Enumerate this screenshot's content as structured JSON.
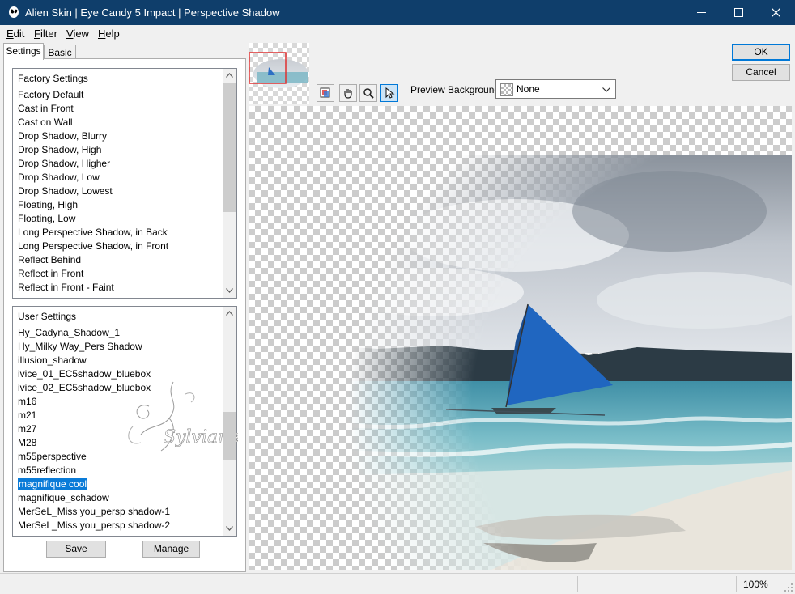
{
  "window": {
    "title": "Alien Skin | Eye Candy 5 Impact | Perspective Shadow",
    "controls": [
      "minimize-icon",
      "maximize-icon",
      "close-icon"
    ]
  },
  "menu": {
    "edit": {
      "accel": "E",
      "rest": "dit"
    },
    "filter": {
      "accel": "F",
      "rest": "ilter"
    },
    "view": {
      "accel": "V",
      "rest": "iew"
    },
    "help": {
      "accel": "H",
      "rest": "elp"
    }
  },
  "tabs": {
    "settings": "Settings",
    "basic": "Basic"
  },
  "factory": {
    "header": "Factory Settings",
    "items": [
      "Factory Default",
      "Cast in Front",
      "Cast on Wall",
      "Drop Shadow, Blurry",
      "Drop Shadow, High",
      "Drop Shadow, Higher",
      "Drop Shadow, Low",
      "Drop Shadow, Lowest",
      "Floating, High",
      "Floating, Low",
      "Long Perspective Shadow, in Back",
      "Long Perspective Shadow, in Front",
      "Reflect Behind",
      "Reflect in Front",
      "Reflect in Front - Faint"
    ]
  },
  "user": {
    "header": "User Settings",
    "selected": "magnifique cool",
    "items": [
      "Hy_Cadyna_Shadow_1",
      "Hy_Milky Way_Pers Shadow",
      "illusion_shadow",
      "ivice_01_EC5shadow_bluebox",
      "ivice_02_EC5shadow_bluebox",
      "m16",
      "m21",
      "m27",
      "M28",
      "m55perspective",
      "m55reflection",
      "magnifique cool",
      "magnifique_schadow",
      "MerSeL_Miss you_persp shadow-1",
      "MerSeL_Miss you_persp shadow-2"
    ]
  },
  "buttons": {
    "save": "Save",
    "manage": "Manage",
    "ok": "OK",
    "cancel": "Cancel"
  },
  "preview": {
    "background_label": "Preview Background:",
    "background_value": "None",
    "tools": [
      "navigator-icon",
      "hand-icon",
      "zoom-icon",
      "pointer-icon"
    ],
    "watermark": "Sylviane"
  },
  "status": {
    "zoom": "100%"
  }
}
